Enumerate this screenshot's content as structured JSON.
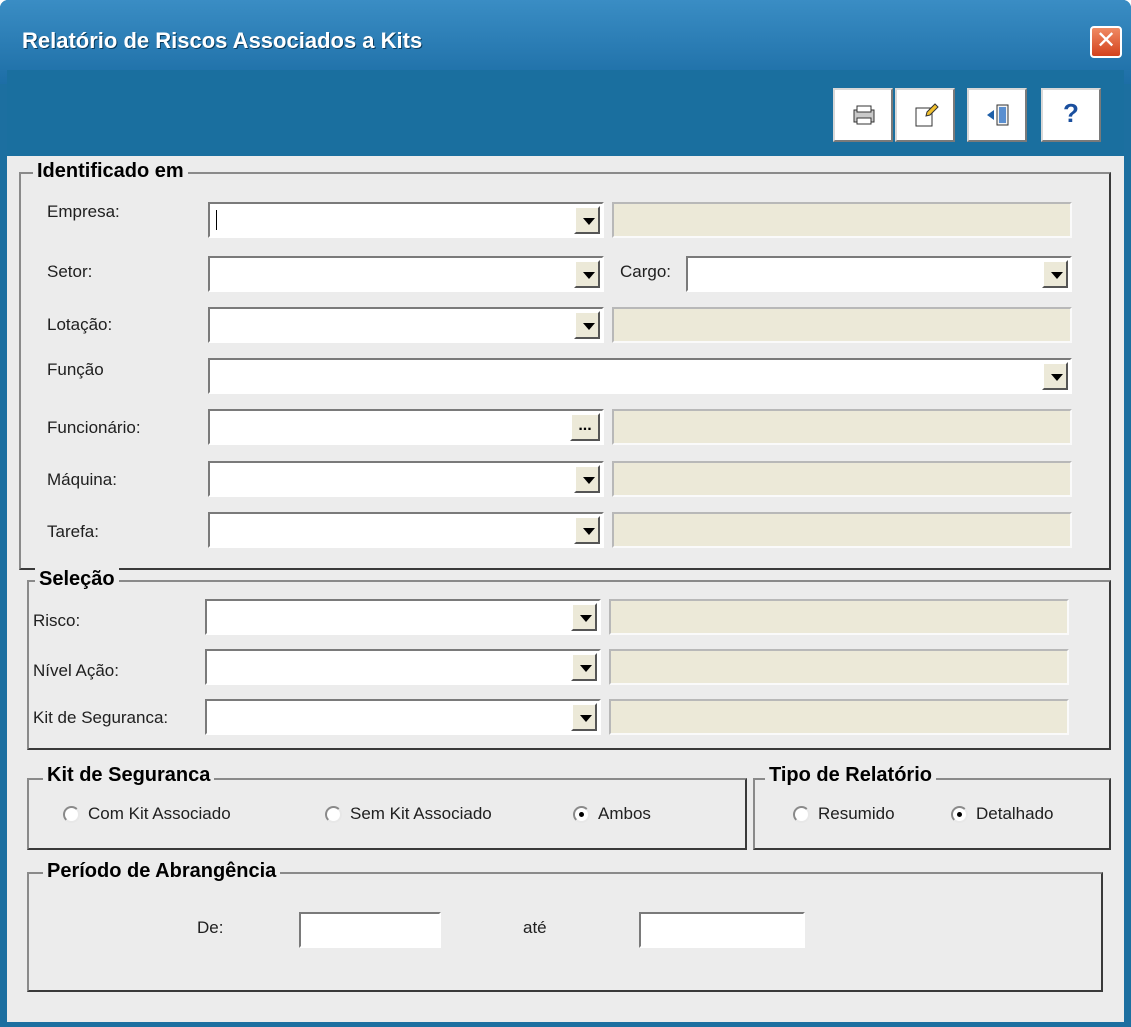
{
  "window": {
    "title": "Relatório de Riscos Associados a Kits",
    "close_label": "✕"
  },
  "toolbar": {
    "buttons": [
      "print-icon",
      "edit-icon",
      "exit-icon",
      "help-icon"
    ],
    "help_label": "?"
  },
  "identificado": {
    "legend": "Identificado em",
    "empresa_label": "Empresa:",
    "setor_label": "Setor:",
    "cargo_label": "Cargo:",
    "lotacao_label": "Lotação:",
    "funcao_label": "Função",
    "funcionario_label": "Funcionário:",
    "funcionario_button": "...",
    "maquina_label": "Máquina:",
    "tarefa_label": "Tarefa:"
  },
  "selecao": {
    "legend": "Seleção",
    "risco_label": "Risco:",
    "nivel_label": "Nível Ação:",
    "kit_label": "Kit de Seguranca:"
  },
  "kit": {
    "legend": "Kit de Seguranca",
    "options": [
      "Com Kit Associado",
      "Sem Kit Associado",
      "Ambos"
    ],
    "selected": "Ambos"
  },
  "tipo": {
    "legend": "Tipo de Relatório",
    "options": [
      "Resumido",
      "Detalhado"
    ],
    "selected": "Detalhado"
  },
  "periodo": {
    "legend": "Período de Abrangência",
    "de_label": "De:",
    "ate_label": "até",
    "de_value": "",
    "ate_value": ""
  },
  "colors": {
    "title_bar": "#1d6ea6",
    "toolbar": "#1a6f9f",
    "panel": "#ececec",
    "readonly": "#ece9d8"
  }
}
